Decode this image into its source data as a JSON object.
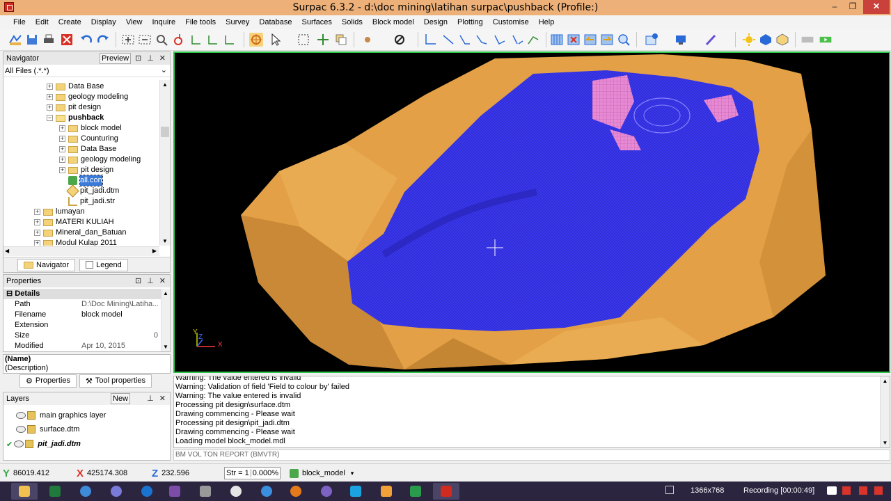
{
  "window": {
    "title": "Surpac 6.3.2 - d:\\doc mining\\latihan surpac\\pushback (Profile:)",
    "min": "–",
    "max": "❐",
    "close": "✕",
    "accent": "#ecb078"
  },
  "menu": [
    "File",
    "Edit",
    "Create",
    "Display",
    "View",
    "Inquire",
    "File tools",
    "Survey",
    "Database",
    "Surfaces",
    "Solids",
    "Block model",
    "Design",
    "Plotting",
    "Customise",
    "Help"
  ],
  "navigator": {
    "title": "Navigator",
    "preview_label": "Preview",
    "pin": "⊡",
    "dock": "⊥",
    "close": "✕",
    "filter": "All Files (.*.*)",
    "tree": [
      {
        "label": "Data Base",
        "level": 3,
        "type": "folder",
        "toggle": "+"
      },
      {
        "label": "geology modeling",
        "level": 3,
        "type": "folder",
        "toggle": "+"
      },
      {
        "label": "pit design",
        "level": 3,
        "type": "folder",
        "toggle": "+"
      },
      {
        "label": "pushback",
        "level": 3,
        "type": "folder-open",
        "toggle": "−",
        "bold": true
      },
      {
        "label": "block model",
        "level": 4,
        "type": "folder",
        "toggle": "+"
      },
      {
        "label": "Counturing",
        "level": 4,
        "type": "folder",
        "toggle": "+"
      },
      {
        "label": "Data Base",
        "level": 4,
        "type": "folder",
        "toggle": "+"
      },
      {
        "label": "geology modeling",
        "level": 4,
        "type": "folder",
        "toggle": "+"
      },
      {
        "label": "pit design",
        "level": 4,
        "type": "folder",
        "toggle": "+"
      },
      {
        "label": "all.con",
        "level": 4,
        "type": "con",
        "toggle": "",
        "selected": true
      },
      {
        "label": "pit_jadi.dtm",
        "level": 4,
        "type": "dtm",
        "toggle": ""
      },
      {
        "label": "pit_jadi.str",
        "level": 4,
        "type": "str",
        "toggle": ""
      },
      {
        "label": "lumayan",
        "level": 2,
        "type": "folder",
        "toggle": "+"
      },
      {
        "label": "MATERI KULIAH",
        "level": 2,
        "type": "folder",
        "toggle": "+"
      },
      {
        "label": "Mineral_dan_Batuan",
        "level": 2,
        "type": "folder",
        "toggle": "+"
      },
      {
        "label": "Modul Kulap 2011",
        "level": 2,
        "type": "folder",
        "toggle": "+"
      }
    ],
    "tabs": [
      "Navigator",
      "Legend"
    ]
  },
  "properties": {
    "title": "Properties",
    "section": "Details",
    "rows": [
      {
        "k": "Path",
        "v": "D:\\Doc Mining\\Latiha..."
      },
      {
        "k": "Filename",
        "v": "block model"
      },
      {
        "k": "Extension",
        "v": ""
      },
      {
        "k": "Size",
        "v": "0"
      },
      {
        "k": "Modified",
        "v": "Apr 10, 2015"
      }
    ],
    "desc_name": "(Name)",
    "desc_text": "(Description)",
    "tabs": [
      "Properties",
      "Tool properties"
    ]
  },
  "layers": {
    "title": "Layers",
    "new_label": "New",
    "items": [
      {
        "label": "main graphics layer",
        "active": false
      },
      {
        "label": "surface.dtm",
        "active": false
      },
      {
        "label": "pit_jadi.dtm",
        "active": true
      }
    ],
    "check": "✔"
  },
  "viewport": {
    "axis_y": "Y",
    "axis_z": "Z",
    "axis_x": "X",
    "bg": "#000000",
    "pit_color": "#e3a046",
    "model_color": "#3b39f0",
    "highlight": "#e78ad4"
  },
  "messages": [
    "Warning: The value entered is invalid",
    "Warning: Validation of field 'Field to colour by' failed",
    "Warning: The value entered is invalid",
    "Processing pit design\\surface.dtm",
    "Drawing commencing - Please wait",
    "Processing pit design\\pit_jadi.dtm",
    "Drawing commencing - Please wait",
    "Loading model block_model.mdl"
  ],
  "command_line": "BM VOL TON REPORT (BMVTR)",
  "status": {
    "y_label": "Y",
    "y_value": "86019.412",
    "x_label": "X",
    "x_value": "425174.308",
    "z_label": "Z",
    "z_value": "232.596",
    "str_label": "Str = 1",
    "percent": "0.000%",
    "model": "block_model"
  },
  "taskbar": {
    "resolution": "1366x768",
    "recording": "Recording [00:00:49]"
  }
}
